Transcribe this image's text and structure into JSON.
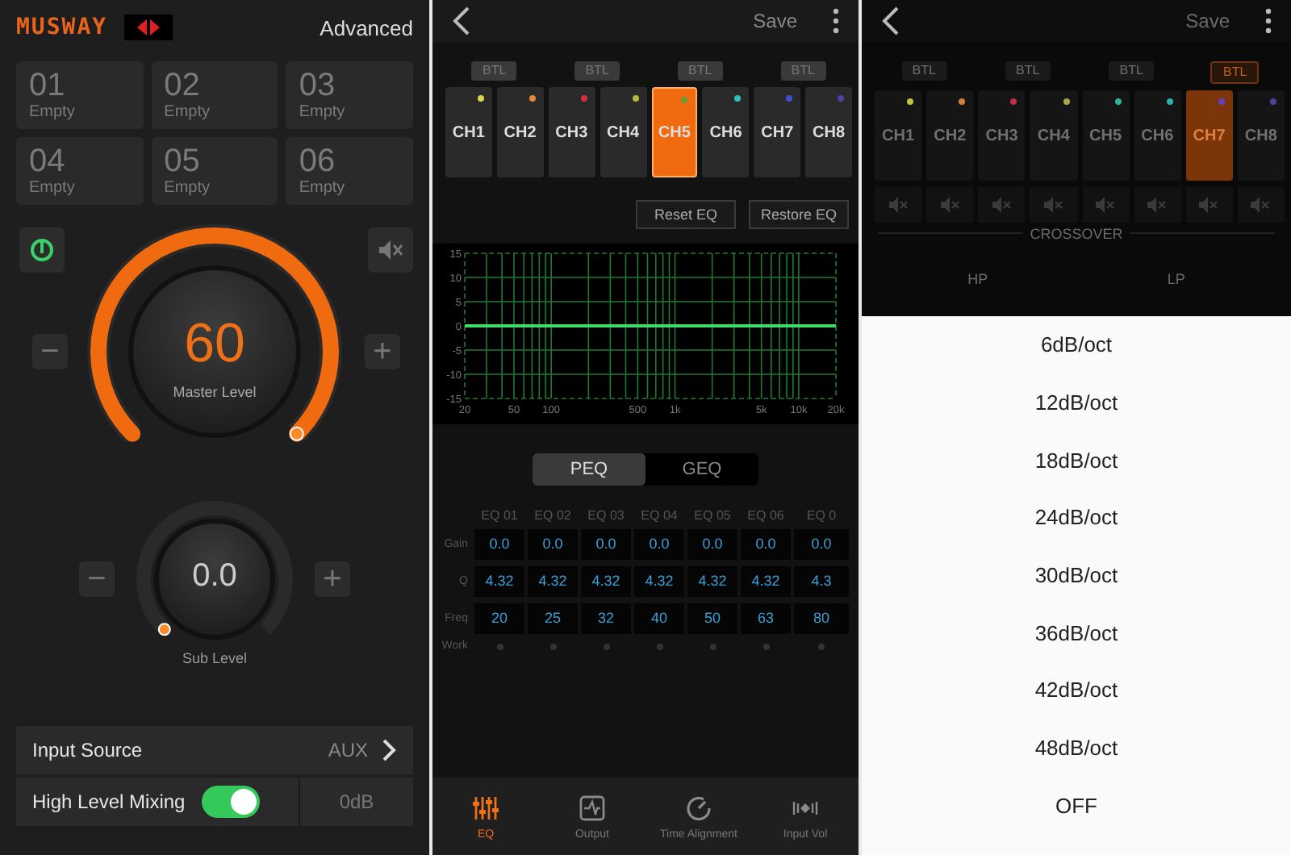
{
  "main_screen": {
    "logo": "MUSWAY",
    "header_link": "Advanced",
    "presets": [
      {
        "number": "01",
        "label": "Empty"
      },
      {
        "number": "02",
        "label": "Empty"
      },
      {
        "number": "03",
        "label": "Empty"
      },
      {
        "number": "04",
        "label": "Empty"
      },
      {
        "number": "05",
        "label": "Empty"
      },
      {
        "number": "06",
        "label": "Empty"
      }
    ],
    "master": {
      "value": "60",
      "label": "Master Level",
      "level": 1,
      "minus": "−",
      "plus": "+"
    },
    "sub": {
      "value": "0.0",
      "label": "Sub Level",
      "minus": "−",
      "plus": "+"
    },
    "settings": [
      {
        "kind": "link",
        "label": "Input Source",
        "value": "AUX"
      },
      {
        "kind": "toggle",
        "label": "High Level Mixing",
        "on": true,
        "value": "0dB"
      }
    ]
  },
  "eq_screen": {
    "save": "Save",
    "btl": [
      "BTL",
      "BTL",
      "BTL",
      "BTL"
    ],
    "channels": [
      {
        "label": "CH1",
        "color": "#d8d84a",
        "selected": false
      },
      {
        "label": "CH2",
        "color": "#e08a3a",
        "selected": false
      },
      {
        "label": "CH3",
        "color": "#d03040",
        "selected": false
      },
      {
        "label": "CH4",
        "color": "#b8b840",
        "selected": false
      },
      {
        "label": "CH5",
        "color": "#6a9a30",
        "selected": true
      },
      {
        "label": "CH6",
        "color": "#30c0c0",
        "selected": false
      },
      {
        "label": "CH7",
        "color": "#4050d0",
        "selected": false
      },
      {
        "label": "CH8",
        "color": "#5040a0",
        "selected": false
      }
    ],
    "buttons": [
      "Reset EQ",
      "Restore EQ"
    ],
    "chart_data": {
      "type": "line",
      "categories": [
        "20",
        "50",
        "100",
        "500",
        "1k",
        "5k",
        "10k",
        "20k"
      ],
      "series": [
        {
          "color": "#3ddc6a",
          "values": [
            0,
            0,
            0,
            0,
            0,
            0,
            0,
            0
          ]
        }
      ],
      "ylim": [
        -15,
        15
      ],
      "grid": true,
      "yticks": [
        15,
        10,
        5,
        0,
        -5,
        -10,
        -15
      ]
    },
    "modes": [
      {
        "label": "PEQ",
        "selected": true
      },
      {
        "label": "GEQ",
        "selected": false
      }
    ],
    "table": {
      "columns": [
        "EQ 01",
        "EQ 02",
        "EQ 03",
        "EQ 04",
        "EQ 05",
        "EQ 06",
        "EQ 0"
      ],
      "rows": [
        {
          "label": "Gain",
          "values": [
            "0.0",
            "0.0",
            "0.0",
            "0.0",
            "0.0",
            "0.0",
            "0.0"
          ]
        },
        {
          "label": "Q",
          "values": [
            "4.32",
            "4.32",
            "4.32",
            "4.32",
            "4.32",
            "4.32",
            "4.3"
          ]
        },
        {
          "label": "Freq",
          "values": [
            "20",
            "25",
            "32",
            "40",
            "50",
            "63",
            "80"
          ]
        }
      ],
      "work_label": "Work",
      "work": [
        false,
        false,
        false,
        false,
        false,
        false,
        false
      ]
    },
    "tabs": [
      {
        "label": "EQ",
        "selected": true
      },
      {
        "label": "Output",
        "selected": false
      },
      {
        "label": "Time Alignment",
        "selected": false
      },
      {
        "label": "Input Vol",
        "selected": false
      }
    ]
  },
  "crossover_screen": {
    "save": "Save",
    "btl": [
      {
        "label": "BTL",
        "selected": false
      },
      {
        "label": "BTL",
        "selected": false
      },
      {
        "label": "BTL",
        "selected": false
      },
      {
        "label": "BTL",
        "selected": true
      }
    ],
    "channels": [
      {
        "label": "CH1",
        "color": "#c8c040",
        "selected": false
      },
      {
        "label": "CH2",
        "color": "#d08030",
        "selected": false
      },
      {
        "label": "CH3",
        "color": "#c03040",
        "selected": false
      },
      {
        "label": "CH4",
        "color": "#a8a840",
        "selected": false
      },
      {
        "label": "CH5",
        "color": "#30b0a0",
        "selected": false
      },
      {
        "label": "CH6",
        "color": "#30b0b0",
        "selected": false
      },
      {
        "label": "CH7",
        "color": "#6040c0",
        "selected": true
      },
      {
        "label": "CH8",
        "color": "#5040a0",
        "selected": false
      }
    ],
    "section": "CROSSOVER",
    "hp": "HP",
    "lp": "LP",
    "options": [
      "6dB/oct",
      "12dB/oct",
      "18dB/oct",
      "24dB/oct",
      "30dB/oct",
      "36dB/oct",
      "42dB/oct",
      "48dB/oct",
      "OFF"
    ]
  }
}
